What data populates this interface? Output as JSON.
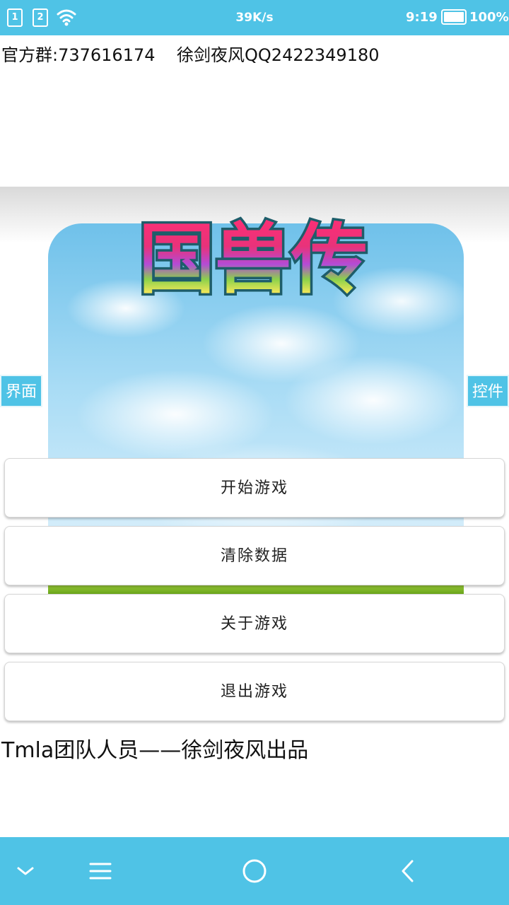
{
  "status_bar": {
    "sim1": "1",
    "sim2": "2",
    "net_speed": "39K/s",
    "time": "9:19",
    "battery": "100%",
    "icons": [
      "sim-card-icon",
      "sim-card-icon",
      "wifi-icon",
      "battery-icon"
    ]
  },
  "header": {
    "info_line": "官方群:737616174    徐剑夜风QQ2422349180"
  },
  "banner": {
    "game_title": "国兽传",
    "left_tab": "界面",
    "right_tab": "控件"
  },
  "menu": {
    "buttons": [
      {
        "label": "开始游戏"
      },
      {
        "label": "清除数据"
      },
      {
        "label": "关于游戏"
      },
      {
        "label": "退出游戏"
      }
    ]
  },
  "footer": {
    "credit": "Tmla团队人员——徐剑夜风出品"
  },
  "nav_bar": {
    "icons": [
      "chevron-down-icon",
      "menu-icon",
      "home-icon",
      "back-icon"
    ]
  },
  "colors": {
    "accent": "#4fc3e6",
    "background": "#ffffff"
  }
}
